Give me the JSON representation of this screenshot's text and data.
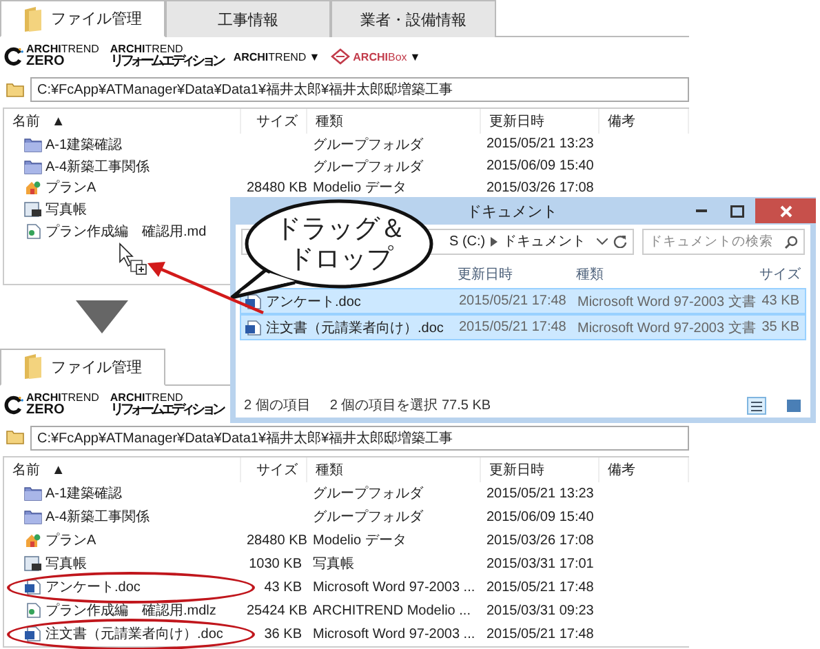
{
  "before_panel": {
    "tabs": [
      {
        "label": "ファイル管理",
        "kind": "with-icon",
        "selected": true
      },
      {
        "label": "工事情報",
        "kind": "plain",
        "selected": false
      },
      {
        "label": "業者・設備情報",
        "kind": "plain",
        "selected": false
      }
    ],
    "logos": [
      {
        "kind": "zero",
        "lines": [
          "**ARCHI**TREND",
          "ZERO"
        ]
      },
      {
        "kind": "reform",
        "lines": [
          "**ARCHI**TREND",
          "リフォームエディション"
        ]
      },
      {
        "kind": "menu",
        "text": "**ARCHI**TREND",
        "caret": "▼"
      },
      {
        "kind": "box",
        "text": "**ARCHI**Box",
        "caret": "▼"
      }
    ],
    "path": "C:¥FcApp¥ATManager¥Data¥Data1¥福井太郎¥福井太郎邸増築工事",
    "columns": [
      "名前",
      "サイズ",
      "種類",
      "更新日時",
      "備考"
    ],
    "sort_mark": "▲",
    "rows": [
      {
        "kind": "group-folder",
        "name": "A-1建築確認",
        "type": "グループフォルダ",
        "modified": "2015/05/21 13:23"
      },
      {
        "kind": "group-folder",
        "name": "A-4新築工事関係",
        "type": "グループフォルダ",
        "modified": "2015/06/09 15:40"
      },
      {
        "kind": "modelio",
        "name": "プランA",
        "size": "28480 KB",
        "type": "Modelio データ",
        "modified": "2015/03/26 17:08"
      },
      {
        "kind": "photo-album",
        "name": "写真帳"
      },
      {
        "kind": "mdlz",
        "name": "プラン作成編　確認用.md"
      }
    ]
  },
  "explorer": {
    "title": "ドキュメント",
    "address": [
      "S (C:)",
      "ドキュメント"
    ],
    "search": {
      "placeholder": "ドキュメントの検索"
    },
    "columns": [
      "更新日時",
      "種類",
      "サイズ"
    ],
    "rows": [
      {
        "name": "アンケート.doc",
        "modified": "2015/05/21 17:48",
        "type": "Microsoft Word 97-2003 文書",
        "size": "43 KB",
        "selected": true
      },
      {
        "name": "注文書（元請業者向け）.doc",
        "modified": "2015/05/21 17:48",
        "type": "Microsoft Word 97-2003 文書",
        "size": "35 KB",
        "selected": true
      }
    ],
    "status": [
      "2 個の項目",
      "2 個の項目を選択  77.5 KB"
    ]
  },
  "callout": {
    "lines": [
      "ドラッグ＆",
      "ドロップ"
    ]
  },
  "after_panel": {
    "tabs": [
      {
        "label": "ファイル管理",
        "kind": "with-icon",
        "selected": true
      }
    ],
    "logos": [
      {
        "kind": "zero",
        "lines": [
          "**ARCHI**TREND",
          "ZERO"
        ]
      },
      {
        "kind": "reform",
        "lines": [
          "**ARCHI**TREND",
          "リフォームエディション"
        ]
      }
    ],
    "path": "C:¥FcApp¥ATManager¥Data¥Data1¥福井太郎¥福井太郎邸増築工事",
    "columns": [
      "名前",
      "サイズ",
      "種類",
      "更新日時",
      "備考"
    ],
    "sort_mark": "▲",
    "rows": [
      {
        "kind": "group-folder",
        "name": "A-1建築確認",
        "type": "グループフォルダ",
        "modified": "2015/05/21 13:23",
        "highlighted": false
      },
      {
        "kind": "group-folder",
        "name": "A-4新築工事関係",
        "type": "グループフォルダ",
        "modified": "2015/06/09 15:40",
        "highlighted": false
      },
      {
        "kind": "modelio",
        "name": "プランA",
        "size": "28480 KB",
        "type": "Modelio データ",
        "modified": "2015/03/26 17:08",
        "highlighted": false
      },
      {
        "kind": "photo-album",
        "name": "写真帳",
        "size": "1030 KB",
        "type": "写真帳",
        "modified": "2015/03/31 17:01",
        "highlighted": false
      },
      {
        "kind": "word-doc",
        "name": "アンケート.doc",
        "size": "43 KB",
        "type": "Microsoft Word 97-2003 ...",
        "modified": "2015/05/21 17:48",
        "highlighted": true
      },
      {
        "kind": "mdlz",
        "name": "プラン作成編　確認用.mdlz",
        "size": "25424 KB",
        "type": "ARCHITREND Modelio ...",
        "modified": "2015/03/31 09:23",
        "highlighted": false
      },
      {
        "kind": "word-doc",
        "name": "注文書（元請業者向け）.doc",
        "size": "36 KB",
        "type": "Microsoft Word 97-2003 ...",
        "modified": "2015/05/21 17:48",
        "highlighted": true
      }
    ]
  }
}
